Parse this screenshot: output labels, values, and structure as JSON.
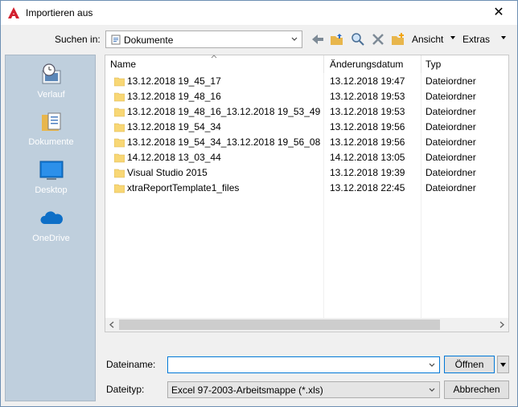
{
  "window": {
    "title": "Importieren aus",
    "close_glyph": "✕"
  },
  "toolbar": {
    "look_in_label": "Suchen in:",
    "look_in_value": "Dokumente",
    "view_label": "Ansicht",
    "tools_label": "Extras"
  },
  "places": [
    {
      "label": "Verlauf",
      "icon": "history-icon"
    },
    {
      "label": "Dokumente",
      "icon": "documents-icon"
    },
    {
      "label": "Desktop",
      "icon": "desktop-icon"
    },
    {
      "label": "OneDrive",
      "icon": "onedrive-icon"
    }
  ],
  "columns": {
    "name": "Name",
    "date": "Änderungsdatum",
    "type": "Typ"
  },
  "files": [
    {
      "name": "13.12.2018 19_45_17",
      "date": "13.12.2018 19:47",
      "type": "Dateiordner"
    },
    {
      "name": "13.12.2018 19_48_16",
      "date": "13.12.2018 19:53",
      "type": "Dateiordner"
    },
    {
      "name": "13.12.2018 19_48_16_13.12.2018 19_53_49",
      "date": "13.12.2018 19:53",
      "type": "Dateiordner"
    },
    {
      "name": "13.12.2018 19_54_34",
      "date": "13.12.2018 19:56",
      "type": "Dateiordner"
    },
    {
      "name": "13.12.2018 19_54_34_13.12.2018 19_56_08",
      "date": "13.12.2018 19:56",
      "type": "Dateiordner"
    },
    {
      "name": "14.12.2018 13_03_44",
      "date": "14.12.2018 13:05",
      "type": "Dateiordner"
    },
    {
      "name": "Visual Studio 2015",
      "date": "13.12.2018 19:39",
      "type": "Dateiordner"
    },
    {
      "name": "xtraReportTemplate1_files",
      "date": "13.12.2018 22:45",
      "type": "Dateiordner"
    }
  ],
  "filename": {
    "label": "Dateiname:",
    "value": ""
  },
  "filetype": {
    "label": "Dateityp:",
    "value": "Excel 97-2003-Arbeitsmappe (*.xls)"
  },
  "buttons": {
    "open": "Öffnen",
    "cancel": "Abbrechen"
  },
  "colors": {
    "sidebar": "#bfcfdd",
    "folder": "#f8d775",
    "selection_border": "#0078d7"
  }
}
